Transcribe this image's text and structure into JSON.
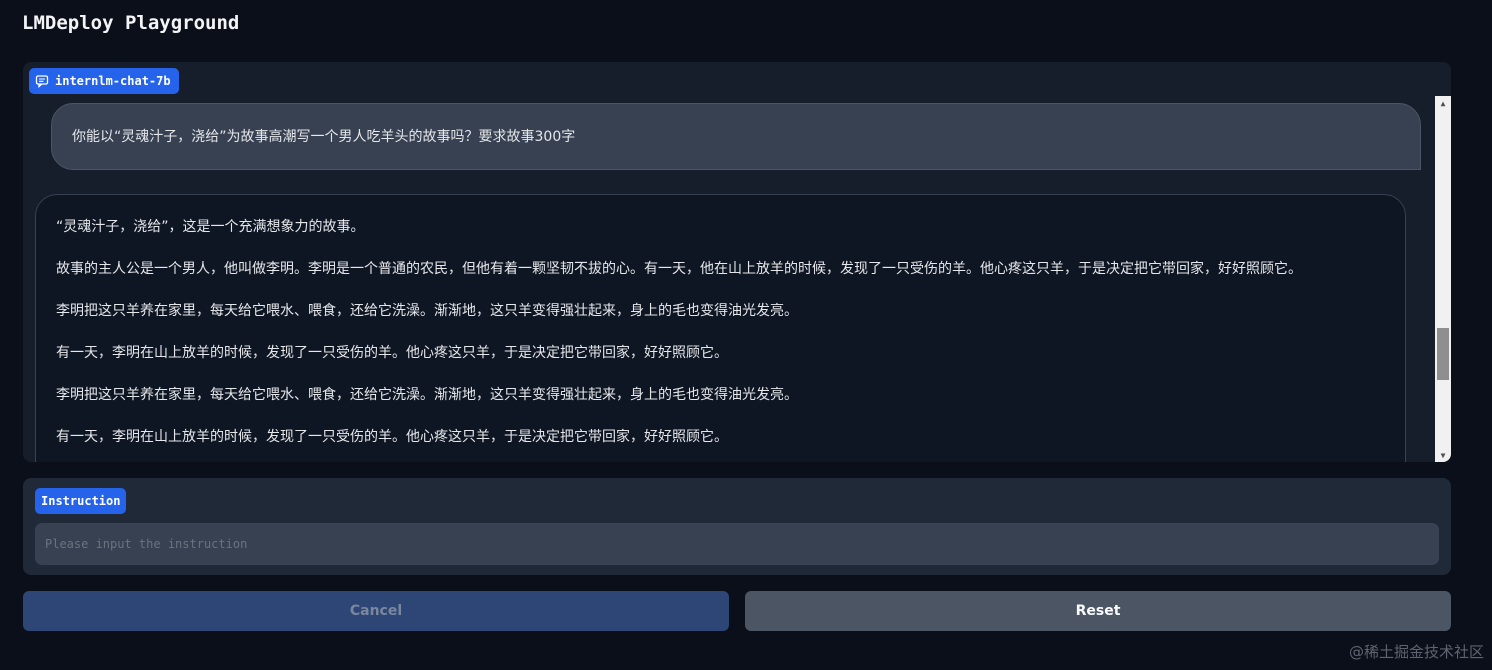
{
  "app": {
    "title": "LMDeploy Playground"
  },
  "chat": {
    "model_label": "internlm-chat-7b",
    "user_message": "你能以“灵魂汁子，浇给”为故事高潮写一个男人吃羊头的故事吗？要求故事300字",
    "bot_paragraphs": [
      "“灵魂汁子，浇给”，这是一个充满想象力的故事。",
      "故事的主人公是一个男人，他叫做李明。李明是一个普通的农民，但他有着一颗坚韧不拔的心。有一天，他在山上放羊的时候，发现了一只受伤的羊。他心疼这只羊，于是决定把它带回家，好好照顾它。",
      "李明把这只羊养在家里，每天给它喂水、喂食，还给它洗澡。渐渐地，这只羊变得强壮起来，身上的毛也变得油光发亮。",
      "有一天，李明在山上放羊的时候，发现了一只受伤的羊。他心疼这只羊，于是决定把它带回家，好好照顾它。",
      "李明把这只羊养在家里，每天给它喂水、喂食，还给它洗澡。渐渐地，这只羊变得强壮起来，身上的毛也变得油光发亮。",
      "有一天，李明在山上放羊的时候，发现了一只受伤的羊。他心疼这只羊，于是决定把它带回家，好好照顾它。"
    ],
    "icon": "chat-bubble-icon"
  },
  "instruction": {
    "label": "Instruction",
    "placeholder": "Please input the instruction",
    "value": ""
  },
  "buttons": {
    "cancel": "Cancel",
    "reset": "Reset"
  },
  "watermark": "@稀土掘金技术社区",
  "colors": {
    "background": "#0b0f19",
    "panel": "#161d2b",
    "accent": "#2563eb",
    "user_bubble": "#374151",
    "cancel_button": "#2d4676",
    "reset_button": "#4b5563"
  }
}
